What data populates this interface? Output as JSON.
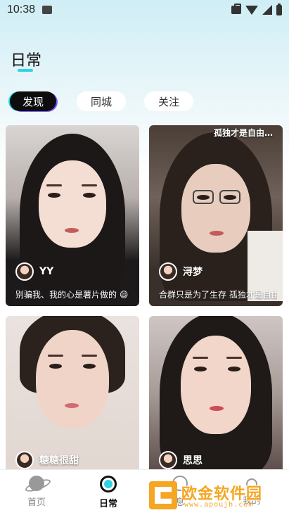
{
  "status_bar": {
    "time": "10:38"
  },
  "header": {
    "title": "日常"
  },
  "filter_tabs": [
    {
      "label": "发现",
      "active": true
    },
    {
      "label": "同城",
      "active": false
    },
    {
      "label": "关注",
      "active": false
    }
  ],
  "cards": [
    {
      "username": "YY",
      "caption": "别骗我、我的心是薯片做的 😄"
    },
    {
      "username": "浔梦",
      "caption": "合群只是为了生存  孤独才是自由…",
      "overlay_text": "孤独才是自由…"
    },
    {
      "username": "糖糖很甜",
      "caption": ""
    },
    {
      "username": "思思",
      "caption": ""
    }
  ],
  "bottom_nav": [
    {
      "label": "首页",
      "icon": "planet-icon",
      "active": false
    },
    {
      "label": "日常",
      "icon": "daily-icon",
      "active": true
    },
    {
      "label": "息",
      "icon": "message-icon",
      "active": false
    },
    {
      "label": "我的",
      "icon": "profile-icon",
      "active": false
    }
  ],
  "watermark": {
    "title": "欧金软件园",
    "url": "www.apoujh.com"
  },
  "colors": {
    "accent": "#2fd3e4",
    "active_tab_bg": "#0d0d0d",
    "watermark": "#f5a623"
  }
}
